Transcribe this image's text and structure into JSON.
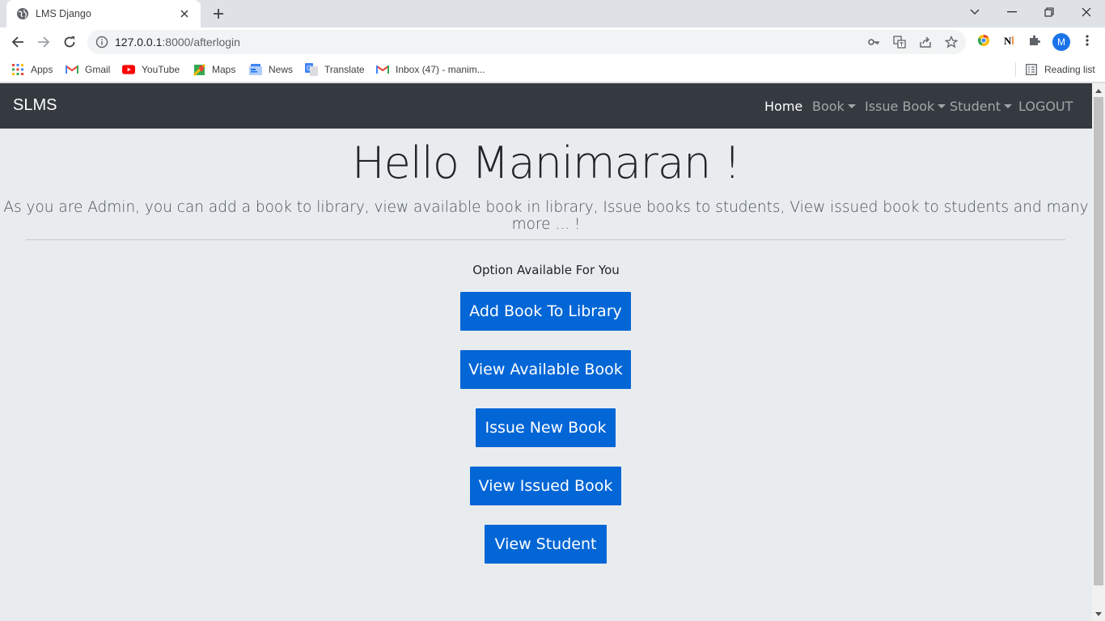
{
  "browser": {
    "tab_title": "LMS Django",
    "url_host": "127.0.0.1",
    "url_rest": ":8000/afterlogin",
    "profile_initial": "M"
  },
  "bookmarks": {
    "items": [
      {
        "label": "Apps",
        "icon": "apps-grid-icon"
      },
      {
        "label": "Gmail",
        "icon": "gmail-icon"
      },
      {
        "label": "YouTube",
        "icon": "youtube-icon"
      },
      {
        "label": "Maps",
        "icon": "maps-icon"
      },
      {
        "label": "News",
        "icon": "news-icon"
      },
      {
        "label": "Translate",
        "icon": "translate-icon"
      },
      {
        "label": "Inbox (47) - manim...",
        "icon": "gmail-icon"
      }
    ],
    "reading_list": "Reading list"
  },
  "navbar": {
    "brand": "SLMS",
    "home": "Home",
    "book": "Book",
    "issue_book": "Issue Book",
    "student": "Student",
    "logout": "LOGOUT"
  },
  "hero": {
    "title": "Hello Manimaran !",
    "lead": "As you are Admin, you can add a book to library, view available book in library, Issue books to students, View issued book to students and many more ... !"
  },
  "options": {
    "label": "Option Available For You",
    "buttons": [
      "Add Book To Library",
      "View Available Book",
      "Issue New Book",
      "View Issued Book",
      "View Student"
    ]
  },
  "colors": {
    "navbar_bg": "#343a40",
    "page_bg": "#e9ecef",
    "button_bg": "#0366d6"
  }
}
